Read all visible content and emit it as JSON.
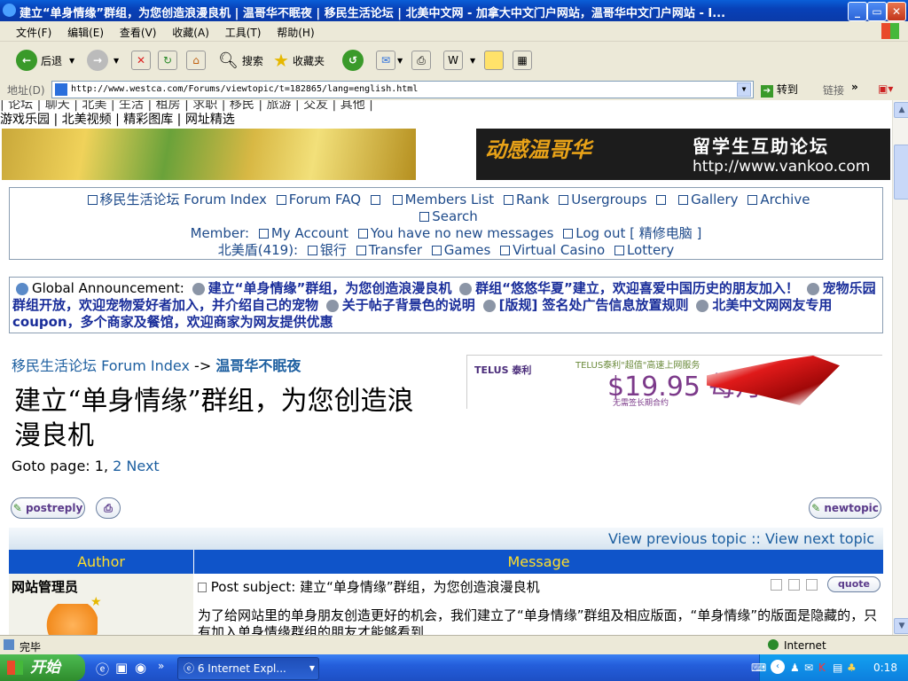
{
  "window": {
    "title": "建立“单身情缘”群组，为您创造浪漫良机 | 温哥华不眠夜 | 移民生活论坛 | 北美中文网 - 加拿大中文门户网站，温哥华中文门户网站 - I..."
  },
  "menu": [
    "文件(F)",
    "编辑(E)",
    "查看(V)",
    "收藏(A)",
    "工具(T)",
    "帮助(H)"
  ],
  "toolbar": {
    "back": "后退",
    "search": "搜索",
    "favorites": "收藏夹"
  },
  "address": {
    "label": "地址(D)",
    "url": "http://www.westca.com/Forums/viewtopic/t=182865/lang=english.html",
    "go": "转到",
    "links": "链接"
  },
  "page": {
    "toplinks": "游戏乐园 | 北美视频 | 精彩图库 | 网址精选",
    "banner_text1": "留学生互助论坛",
    "banner_text2": "http://www.vankoo.com",
    "banner_logo": "动感温哥华",
    "nav": {
      "forum_index": "移民生活论坛 Forum Index",
      "faq": "Forum FAQ",
      "members": "Members List",
      "rank": "Rank",
      "usergroups": "Usergroups",
      "gallery": "Gallery",
      "archive": "Archive",
      "search": "Search",
      "member_label": "Member:",
      "my_account": "My Account",
      "messages": "You have no new messages",
      "logout": "Log out [ 精修电脑 ]",
      "shield": "北美盾(419):",
      "bank": "银行",
      "transfer": "Transfer",
      "games": "Games",
      "casino": "Virtual Casino",
      "lottery": "Lottery"
    },
    "announcement": {
      "heading": "Global Announcement:",
      "items": [
        "建立“单身情缘”群组，为您创造浪漫良机",
        "群组“悠悠华夏”建立，欢迎喜爱中国历史的朋友加入！",
        "宠物乐园群组开放，欢迎宠物爱好者加入，并介绍自己的宠物",
        "关于帖子背景色的说明",
        "[版规] 签名处广告信息放置规则",
        "北美中文网网友专用coupon，多个商家及餐馆，欢迎商家为网友提供优惠"
      ]
    },
    "breadcrumb": {
      "index": "移民生活论坛 Forum Index",
      "sep": " -> ",
      "forum": "温哥华不眠夜"
    },
    "topic_title": "建立“单身情缘”群组，为您创造浪漫良机",
    "goto": {
      "label": "Goto page:",
      "p1": "1",
      "p2": "2",
      "next": "Next"
    },
    "ad": {
      "brand": "TELUS 泰利",
      "tagline": "TELUS泰利\"超值\"高速上网服务",
      "price": "$19.95 每月",
      "note": "无需签长期合约"
    },
    "buttons": {
      "postreply": "postreply",
      "newtopic": "newtopic",
      "quote": "quote"
    },
    "viewnav": "View previous topic :: View next topic",
    "table": {
      "col_author": "Author",
      "col_message": "Message"
    },
    "post": {
      "author": "网站管理员",
      "subject_label": "Post subject:",
      "subject": "建立“单身情缘”群组，为您创造浪漫良机",
      "body": "为了给网站里的单身朋友创造更好的机会，我们建立了“单身情缘”群组及相应版面，“单身情缘”的版面是隐藏的，只有加入单身情缘群组的朋友才能够看到"
    }
  },
  "status": {
    "text": "完毕",
    "zone": "Internet"
  },
  "taskbar": {
    "start": "开始",
    "task": "6 Internet Expl...",
    "clock": "0:18"
  }
}
